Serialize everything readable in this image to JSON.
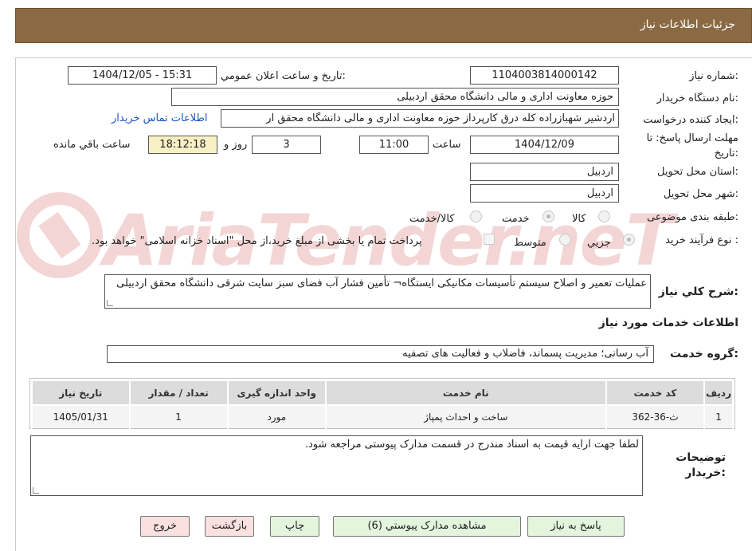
{
  "header": {
    "title": "جزئیات اطلاعات نیاز"
  },
  "watermark": {
    "text": "AriaTender.neT"
  },
  "fields": {
    "need_number_label": "شماره نیاز:",
    "need_number": "1104003814000142",
    "announce_label": "تاریخ و ساعت اعلان عمومي:",
    "announce_value": "1404/12/05 - 15:31",
    "buyer_org_label": "نام دستگاه خريدار:",
    "buyer_org": "حوزه معاونت اداری و مالی دانشگاه محقق اردبیلی",
    "requester_label": "ايجاد کننده درخواست:",
    "requester": "اردشیر شهبازراده کله درق کارپرداز حوزه معاونت اداری و مالی دانشگاه محقق ار",
    "contact_link": "اطلاعات تماس خريدار",
    "deadline_label_1": "مهلت ارسال پاسخ: تا",
    "deadline_label_2": "تاریخ:",
    "deadline_date": "1404/12/09",
    "time_label": "ساعت",
    "deadline_time": "11:00",
    "days_value": "3",
    "days_label": "روز و",
    "remaining_time": "18:12:18",
    "remaining_label": "ساعت باقي مانده",
    "province_label": "استان محل تحویل:",
    "province": "اردبیل",
    "city_label": "شهر محل تحویل:",
    "city": "اردبیل",
    "category_label": "طبقه بندی موضوعی:",
    "category_options": [
      "کالا",
      "خدمت",
      "کالا/خدمت"
    ],
    "category_selected": "خدمت",
    "process_label": "نوع فرآيند خرید :",
    "process_options": [
      "جزيي",
      "متوسط"
    ],
    "process_selected": "جزيي",
    "payment_note": "پرداخت تمام يا بخشی از مبلغ خريد،از محل \"اسناد خزانه اسلامی\" خواهد بود.",
    "description_label": "شرح کلي نياز:",
    "description": "عملیات تعمیر و اصلاح سیستم تأسیسات مکانیکی ایستگاه¬ تأمین فشار آب فضای سبز سایت شرقی دانشگاه محقق اردبیلی"
  },
  "services": {
    "section_title": "اطلاعات خدمات مورد نیاز",
    "group_label": "گروه خدمت:",
    "group_value": "آب رسانی؛ مدیریت پسماند، فاضلاب و فعالیت های تصفیه",
    "columns": [
      "رديف",
      "کد خدمت",
      "نام خدمت",
      "واحد اندازه گيری",
      "تعداد / مقدار",
      "تاريخ نياز"
    ],
    "rows": [
      [
        "1",
        "ث-36-362",
        "ساخت و احداث پمپاژ",
        "مورد",
        "1",
        "1405/01/31"
      ]
    ]
  },
  "buyer_notes": {
    "label_1": "توضیحات",
    "label_2": "خریدار:",
    "text": "لطفا جهت ارایه قیمت به اسناد مندرج در قسمت مدارک پیوستی مراجعه شود."
  },
  "buttons": {
    "reply": "پاسخ به نياز",
    "attachments": "مشاهده مدارک پيوستي (6)",
    "print": "چاپ",
    "back": "بازگشت",
    "exit": "خروج"
  }
}
